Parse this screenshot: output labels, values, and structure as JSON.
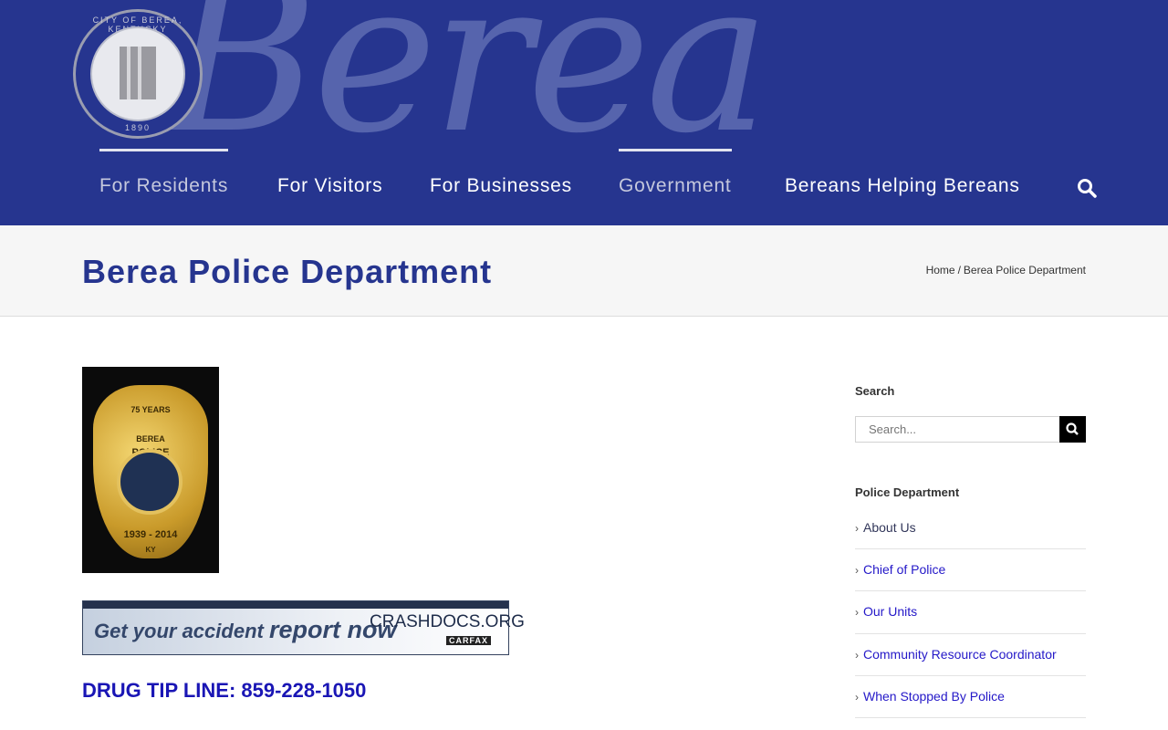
{
  "header": {
    "logo_script": "Berea",
    "seal_text_top": "CITY OF BEREA, KENTUCKY",
    "seal_year": "1890",
    "nav": [
      {
        "label": "For Residents",
        "active": true
      },
      {
        "label": "For Visitors",
        "active": false
      },
      {
        "label": "For Businesses",
        "active": false
      },
      {
        "label": "Government",
        "active": true
      },
      {
        "label": "Bereans Helping Bereans",
        "active": false
      }
    ],
    "search_icon": "search-icon"
  },
  "titlebar": {
    "title": "Berea Police Department",
    "breadcrumb": [
      "Home",
      "/",
      "Berea Police Department"
    ]
  },
  "main": {
    "badge": {
      "years": "75 YEARS",
      "city": "BEREA",
      "word": "POLICE",
      "dates": "1939 - 2014",
      "state": "KY"
    },
    "banner": {
      "text1": "Get your accident",
      "text2": "report now",
      "brand": "CRASHDOCS.ORG",
      "powered": "CARFAX"
    },
    "tip_line": "DRUG TIP LINE: 859-228-1050"
  },
  "sidebar": {
    "search_title": "Search",
    "search_placeholder": "Search...",
    "menu_title": "Police Department",
    "items": [
      "About Us",
      "Chief of Police",
      "Our Units",
      "Community Resource Coordinator",
      "When Stopped By Police"
    ]
  },
  "colors": {
    "brand": "#26358f",
    "link": "#2418c8",
    "tip": "#1a16b5"
  }
}
